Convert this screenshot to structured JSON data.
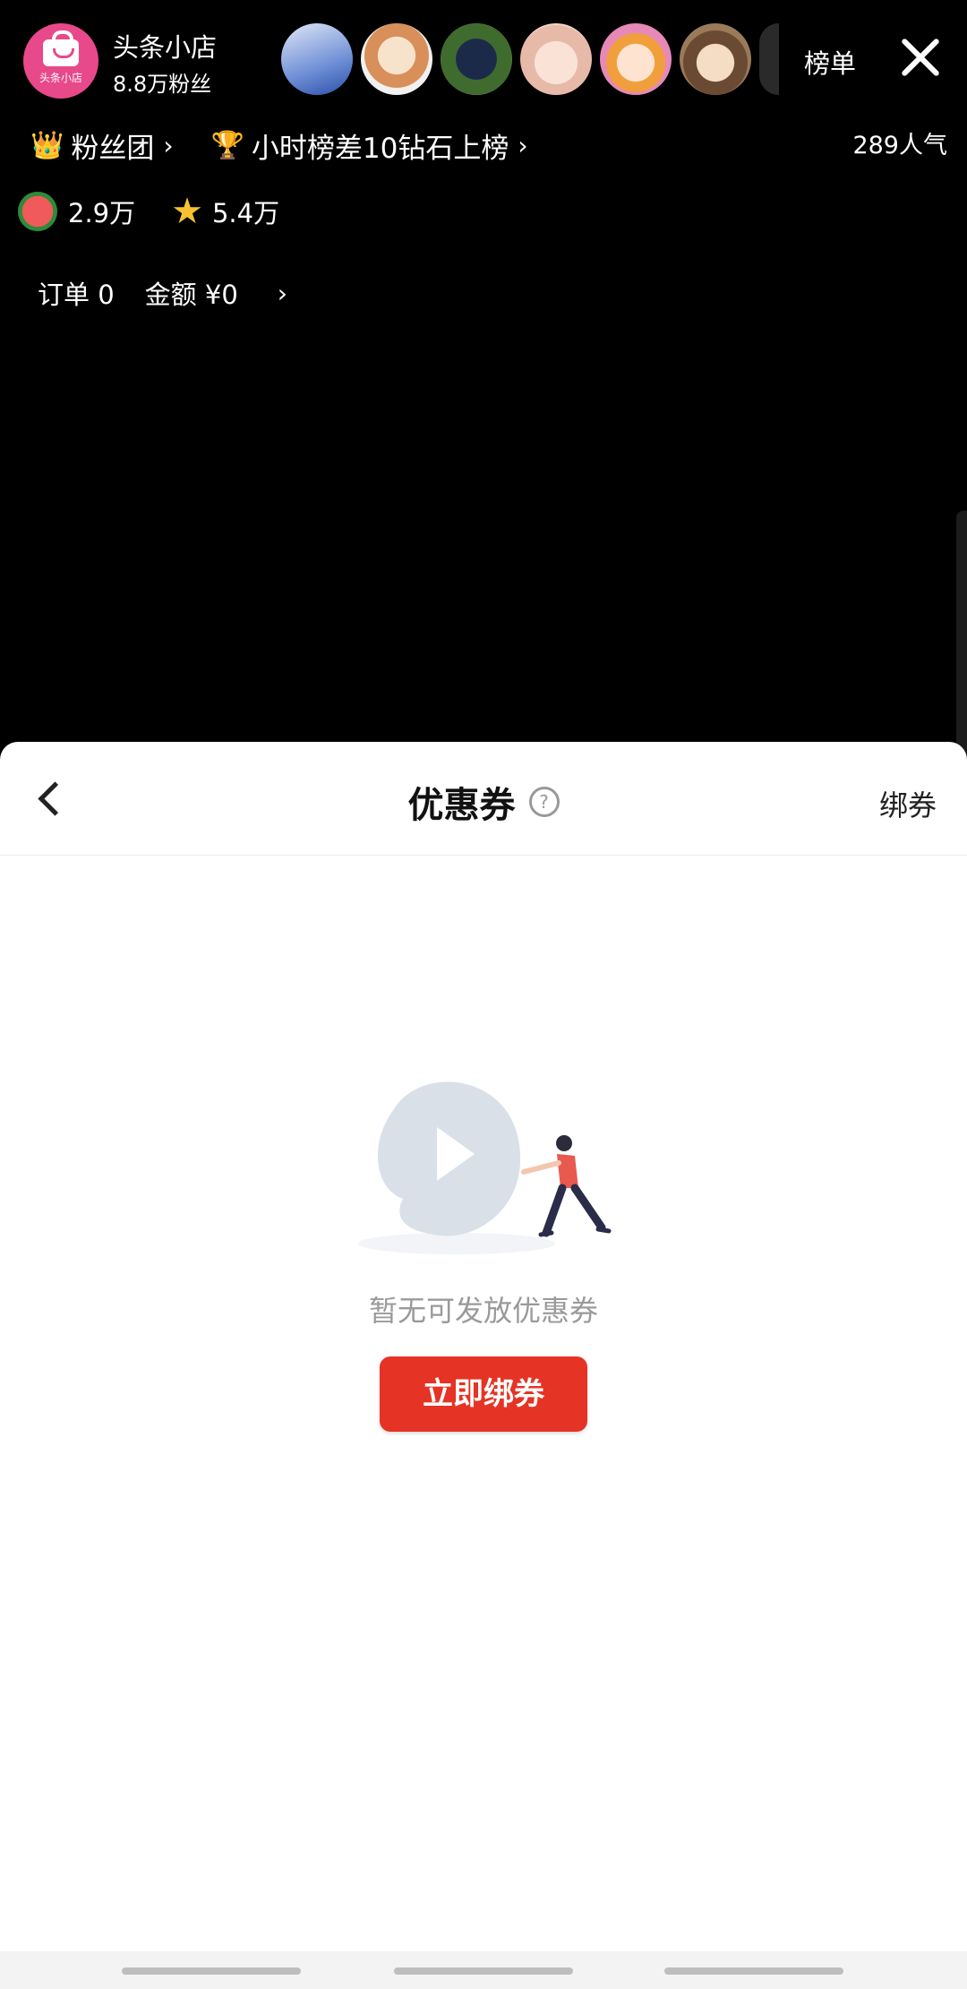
{
  "header": {
    "shop_name": "头条小店",
    "fans": "8.8万粉丝",
    "logo_text": "头条小店",
    "rank_label": "榜单"
  },
  "viewers": [
    {
      "color": "#6f8fd6"
    },
    {
      "color": "#d98f5a"
    },
    {
      "color": "#3f6b2f"
    },
    {
      "color": "#e7b9a8"
    },
    {
      "color": "#e789b8"
    },
    {
      "color": "#9b7a5a"
    }
  ],
  "info": {
    "fan_club": "粉丝团",
    "hourly_rank": "小时榜差10钻石上榜",
    "popularity": "289人气"
  },
  "stats": {
    "melon": "2.9万",
    "star": "5.4万"
  },
  "orders": {
    "order_count": "订单 0",
    "amount": "金额 ¥0"
  },
  "sheet": {
    "title": "优惠券",
    "bind_link": "绑券",
    "empty_text": "暂无可发放优惠券",
    "bind_button": "立即绑券"
  },
  "colors": {
    "primary_red": "#e53325",
    "shop_pink": "#e8498a"
  }
}
